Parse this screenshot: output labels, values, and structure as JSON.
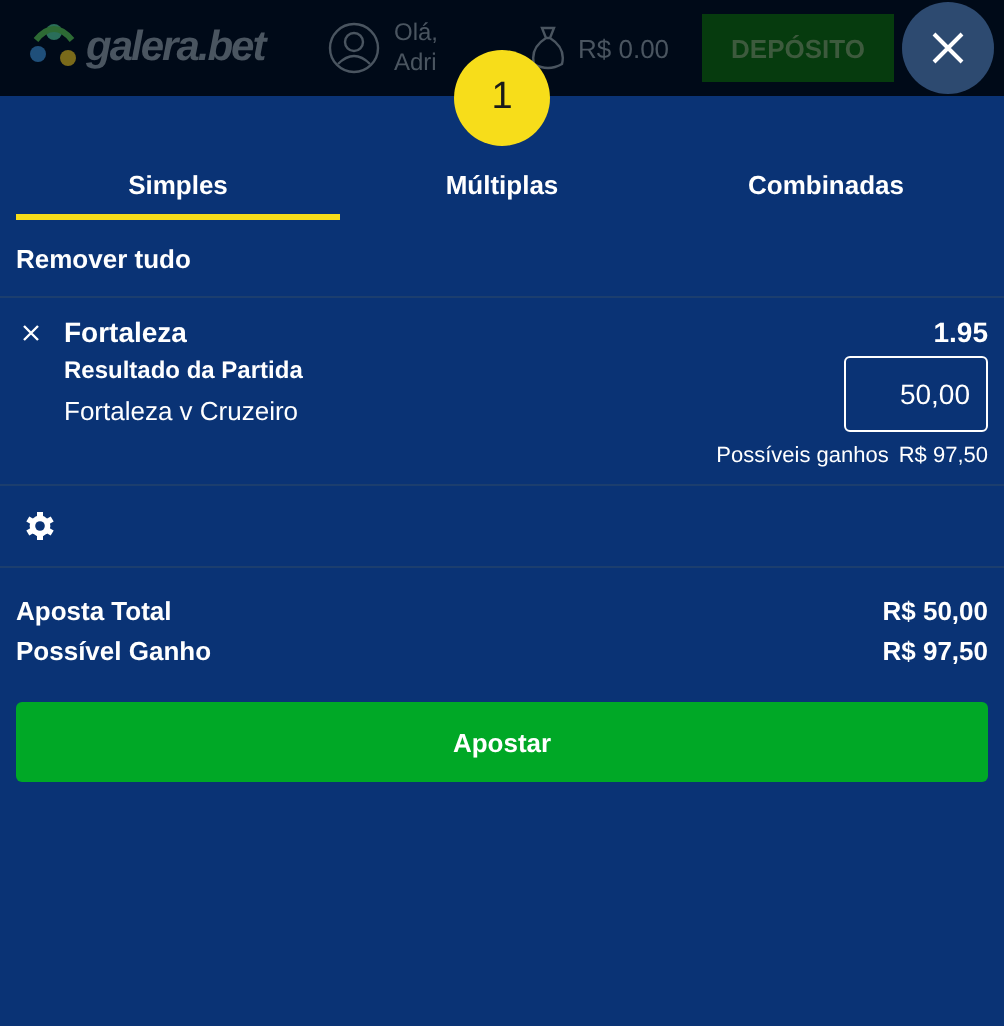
{
  "header": {
    "logo": "galera.bet",
    "greeting": [
      "Olá,",
      "Adri"
    ],
    "balance": "R$ 0.00",
    "deposit": "DEPÓSITO"
  },
  "badge": "1",
  "tabs": [
    {
      "label": "Simples",
      "selected": true
    },
    {
      "label": "Múltiplas",
      "selected": false
    },
    {
      "label": "Combinadas",
      "selected": false
    }
  ],
  "remove_all": "Remover tudo",
  "bets": [
    {
      "selection": "Fortaleza",
      "odds": "1.95",
      "market": "Resultado da Partida",
      "event": "Fortaleza v Cruzeiro",
      "stake": "50,00",
      "winnings_label": "Possíveis ganhos",
      "winnings": "R$ 97,50"
    }
  ],
  "totals": [
    {
      "label": "Aposta Total",
      "value": "R$ 50,00"
    },
    {
      "label": "Possível Ganho",
      "value": "R$ 97,50"
    }
  ],
  "submit": "Apostar"
}
